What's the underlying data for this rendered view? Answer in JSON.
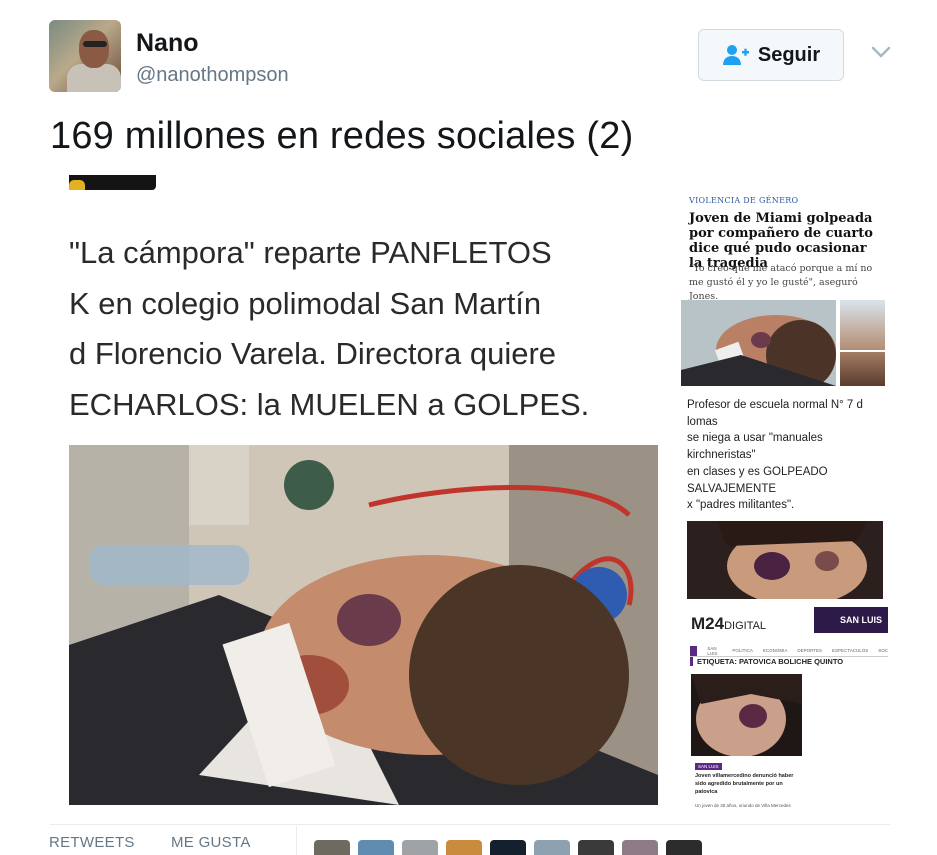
{
  "user": {
    "name": "Nano",
    "handle": "@nanothompson"
  },
  "actions": {
    "follow_label": "Seguir"
  },
  "tweet": {
    "text": "169 millones en redes sociales (2)"
  },
  "image": {
    "left_text_lines": [
      "\"La cámpora\" reparte PANFLETOS",
      "K  en colegio polimodal San Martín",
      "d Florencio Varela. Directora quiere",
      "ECHARLOS: la MUELEN a GOLPES."
    ],
    "right_top": {
      "category": "VIOLENCIA DE GÉNERO",
      "headline": "Joven de Miami golpeada por compañero de cuarto dice qué pudo ocasionar la tragedia",
      "quote": "\"Yo creo que me atacó porque a mí no me gustó él y yo le gusté\", aseguró Jones."
    },
    "right_mid_lines": [
      "Profesor de escuela normal N° 7 d",
      "lomas",
      "se niega a usar \"manuales",
      "kirchneristas\"",
      "en clases y es GOLPEADO",
      "SALVAJEMENTE",
      "x \"padres militantes\"."
    ],
    "right_bottom": {
      "brand": "M24",
      "brand_suffix": "DIGITAL",
      "badge": "SAN LUIS",
      "nav_items": [
        "SAN LUIS",
        "POLITICA",
        "ECONOMIA",
        "DEPORTES",
        "ESPECTACULOS",
        "SOC"
      ],
      "etiqueta": "ETIQUETA: PATOVICA BOLICHE QUINTO",
      "tag": "SAN LUIS",
      "subheadline": "Joven villamercedino denunció haber sido agredido brutalmente por un patovica",
      "subtext": "Un joven de 30 años, oriundo de Villa Mercedes"
    }
  },
  "footer": {
    "retweets_label": "RETWEETS",
    "likes_label": "ME GUSTA"
  },
  "colors": {
    "text": "#14171a",
    "muted": "#657786",
    "follow_icon": "#1da1f2"
  }
}
